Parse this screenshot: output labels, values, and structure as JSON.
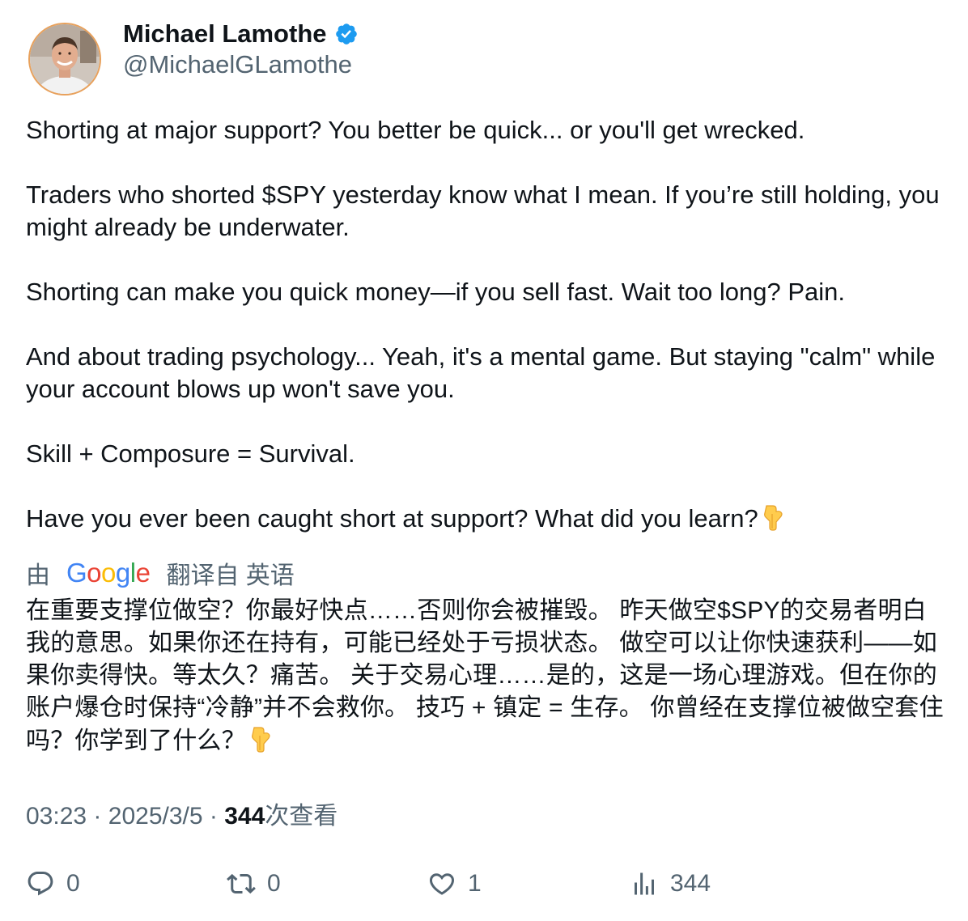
{
  "author": {
    "name": "Michael Lamothe",
    "handle": "@MichaelGLamothe",
    "verified_icon": "verified-badge-icon",
    "avatar_icon": "avatar-photo"
  },
  "tweet": {
    "paragraphs": [
      "Shorting at major support? You better be quick... or you'll get wrecked.",
      "Traders who shorted $SPY yesterday know what I mean. If you’re still holding, you might already be underwater.",
      "Shorting can make you quick money—if you sell fast. Wait too long? Pain.",
      "And about trading psychology... Yeah, it's a mental game. But staying \"calm\" while your account blows up won't save you.",
      "Skill + Composure = Survival.",
      "Have you ever been caught short at support? What did you learn?"
    ],
    "emoji_icon": "pointing-down-hand-emoji"
  },
  "translation": {
    "by_label": "由",
    "google_logo_text": "Google",
    "from_label": "翻译自 英语",
    "text": "在重要支撑位做空？你最好快点……否则你会被摧毁。 昨天做空$SPY的交易者明白我的意思。如果你还在持有，可能已经处于亏损状态。 做空可以让你快速获利——如果你卖得快。等太久？痛苦。 关于交易心理……是的，这是一场心理游戏。但在你的账户爆仓时保持“冷静”并不会救你。 技巧 + 镇定 = 生存。 你曾经在支撑位被做空套住吗？你学到了什么？"
  },
  "meta": {
    "time": "03:23",
    "separator": "·",
    "date": "2025/3/5",
    "views_count": "344",
    "views_label": "次查看"
  },
  "actions": {
    "reply_count": "0",
    "retweet_count": "0",
    "like_count": "1",
    "views_count": "344"
  },
  "colors": {
    "text": "#0f1419",
    "secondary": "#536471",
    "verified": "#1d9bf0"
  }
}
